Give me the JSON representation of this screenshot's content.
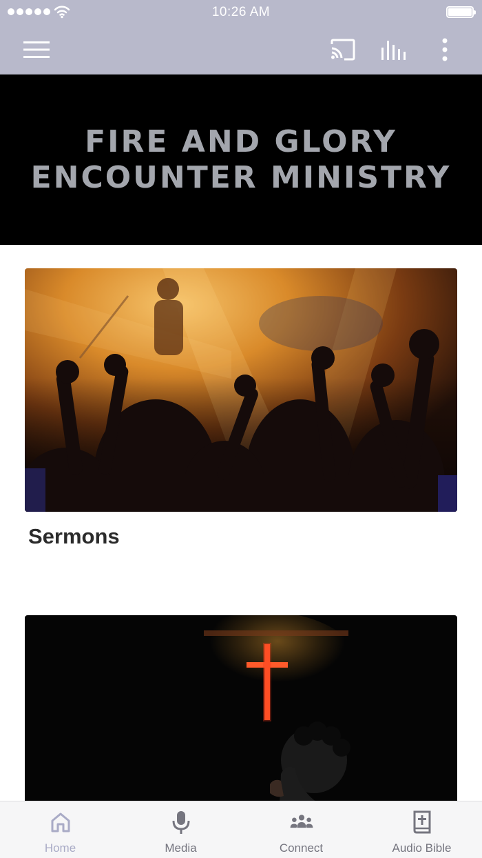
{
  "status_bar": {
    "time": "10:26 AM"
  },
  "nav": {
    "icons": [
      "menu-icon",
      "cast-icon",
      "equalizer-icon",
      "more-vertical-icon"
    ]
  },
  "banner": {
    "line1": "FIRE AND GLORY",
    "line2": "ENCOUNTER MINISTRY"
  },
  "cards": [
    {
      "title": "Sermons",
      "image": "worship-hands-photo"
    },
    {
      "title": "",
      "image": "cross-prayer-photo"
    }
  ],
  "tabs": [
    {
      "label": "Home",
      "icon": "home-icon",
      "active": true
    },
    {
      "label": "Media",
      "icon": "microphone-icon",
      "active": false
    },
    {
      "label": "Connect",
      "icon": "people-icon",
      "active": false
    },
    {
      "label": "Audio Bible",
      "icon": "bible-icon",
      "active": false
    }
  ],
  "colors": {
    "header_bg": "#b8b9cb",
    "banner_bg": "#000000",
    "banner_text": "#a3a6ad",
    "tab_active": "#a9abc6",
    "tab_inactive": "#75757f"
  }
}
